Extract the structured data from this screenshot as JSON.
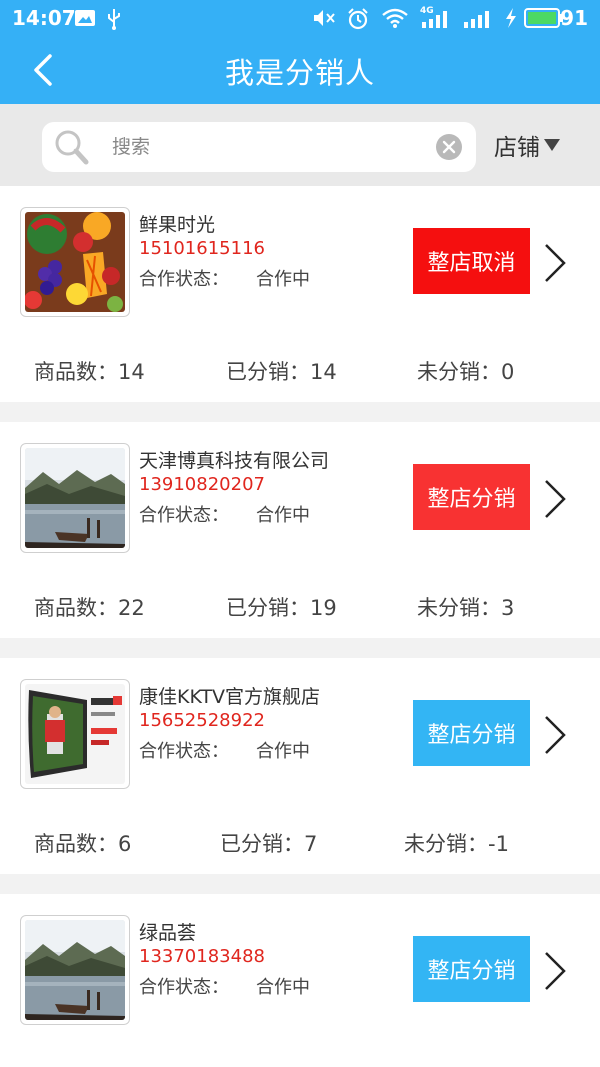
{
  "status_bar": {
    "time": "14:07",
    "battery": "91",
    "icons": [
      "image-icon",
      "usb-icon",
      "mute-icon",
      "alarm-icon",
      "wifi-icon",
      "signal-4g-icon",
      "signal-icon",
      "charging-icon",
      "battery-icon"
    ],
    "network_label": "4G"
  },
  "header": {
    "title": "我是分销人",
    "back_icon": "back-arrow-icon"
  },
  "search": {
    "placeholder": "搜索",
    "value": "",
    "filter_label": "店铺"
  },
  "colors": {
    "primary": "#35b0f6",
    "cancel": "#f50f0f",
    "red": "#f83232",
    "blue": "#33b5f4",
    "phone": "#e0261e"
  },
  "shops": [
    {
      "name": "鲜果时光",
      "phone": "15101615116",
      "status_label": "合作状态：",
      "status_value": "合作中",
      "action": "整店取消",
      "stats": {
        "products": "商品数：14",
        "distributed": "已分销：14",
        "undistributed": "未分销：0"
      }
    },
    {
      "name": "天津博真科技有限公司",
      "phone": "13910820207",
      "status_label": "合作状态：",
      "status_value": "合作中",
      "action": "整店分销",
      "stats": {
        "products": "商品数：22",
        "distributed": "已分销：19",
        "undistributed": "未分销：3"
      }
    },
    {
      "name": "康佳KKTV官方旗舰店",
      "phone": "15652528922",
      "status_label": "合作状态：",
      "status_value": "合作中",
      "action": "整店分销",
      "stats": {
        "products": "商品数：6",
        "distributed": "已分销：7",
        "undistributed": "未分销：-1"
      }
    },
    {
      "name": "绿品荟",
      "phone": "13370183488",
      "status_label": "合作状态：",
      "status_value": "合作中",
      "action": "整店分销",
      "stats": {
        "products": "",
        "distributed": "",
        "undistributed": ""
      }
    }
  ]
}
